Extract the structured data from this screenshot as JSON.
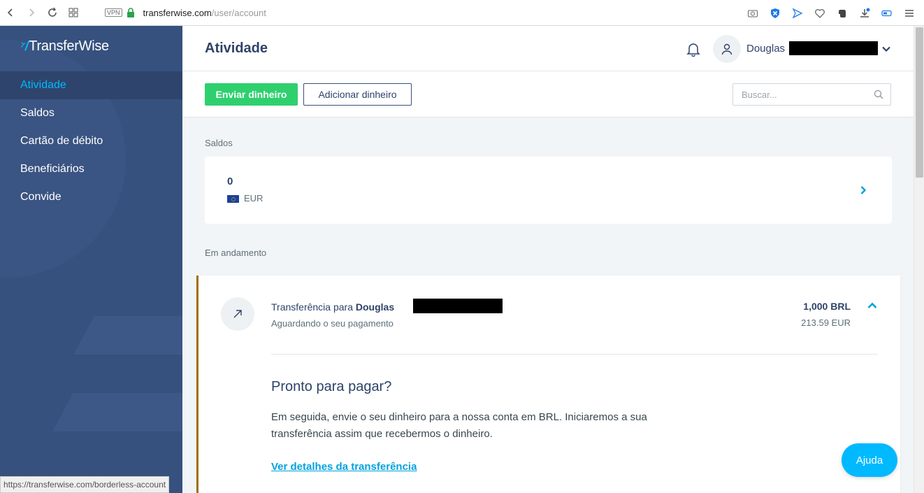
{
  "browser": {
    "url_host": "transferwise.com",
    "url_path": "/user/account",
    "vpn_label": "VPN",
    "status_url": "https://transferwise.com/borderless-account"
  },
  "sidebar": {
    "logo_text": "TransferWise",
    "items": [
      {
        "label": "Atividade",
        "active": true
      },
      {
        "label": "Saldos"
      },
      {
        "label": "Cartão de débito"
      },
      {
        "label": "Beneficiários"
      },
      {
        "label": "Convide"
      }
    ]
  },
  "header": {
    "title": "Atividade",
    "user_name": "Douglas"
  },
  "actions": {
    "send_label": "Enviar dinheiro",
    "add_label": "Adicionar dinheiro",
    "search_placeholder": "Buscar..."
  },
  "balances": {
    "section_label": "Saldos",
    "amount": "0",
    "currency": "EUR"
  },
  "in_progress": {
    "section_label": "Em andamento",
    "transfer": {
      "title_prefix": "Transferência para",
      "recipient": "Douglas",
      "status": "Aguardando o seu pagamento",
      "amount": "1,000 BRL",
      "amount_converted": "213.59 EUR",
      "heading": "Pronto para pagar?",
      "body": "Em seguida, envie o seu dinheiro para a nossa conta em BRL. Iniciaremos a sua transferência assim que recebermos o dinheiro.",
      "details_link": "Ver detalhes da transferência"
    }
  },
  "help": {
    "label": "Ajuda"
  },
  "colors": {
    "sidebar_bg": "#37517e",
    "accent": "#00b9ff",
    "send_button": "#2ed06e",
    "pending_border": "#a26f00"
  }
}
